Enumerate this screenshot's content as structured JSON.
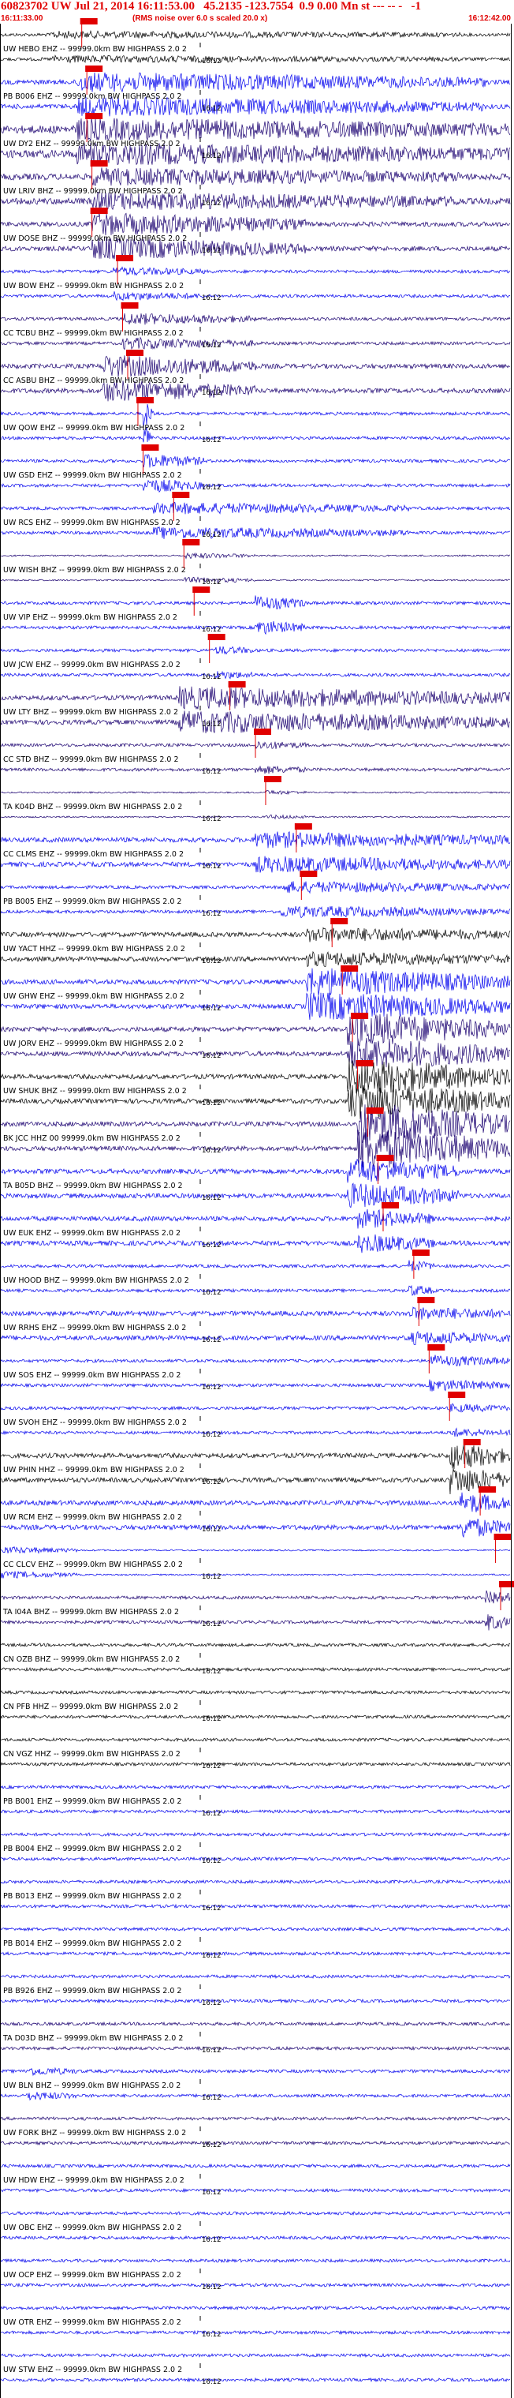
{
  "header": {
    "title": "60823702 UW Jul 21, 2014 16:11:53.00   45.2135 -123.7554  0.9 0.00 Mn st --- -- -   -1",
    "start_time": "16:11:33.00",
    "note": "(RMS noise over 6.0 s scaled 20.0 x)",
    "end_time": "16:12:42.00"
  },
  "tick_label": "16:12",
  "colors": {
    "blue": "#0000ee",
    "black": "#000000",
    "navy": "#1a0070",
    "pick": "#e00000"
  },
  "traces": [
    {
      "label": "UW HEBO EHZ -- 99999.0km BW  HIGHPASS  2.0  2",
      "color": "black",
      "pick": 0.16,
      "amp": 2,
      "burst": [
        0.1,
        0.9,
        3
      ]
    },
    {
      "label": "PB B006 EHZ -- 99999.0km BW  HIGHPASS  2.0  2",
      "color": "blue",
      "pick": 0.17,
      "amp": 3,
      "burst": [
        0.15,
        0.95,
        10
      ]
    },
    {
      "label": "UW DY2 EHZ -- 99999.0km BW  HIGHPASS  2.0  2",
      "color": "navy",
      "pick": 0.17,
      "amp": 5,
      "burst": [
        0.15,
        1.0,
        10
      ]
    },
    {
      "label": "UW LRIV BHZ -- 99999.0km BW  HIGHPASS  2.0  2",
      "color": "navy",
      "pick": 0.18,
      "amp": 4,
      "burst": [
        0.18,
        0.9,
        8
      ]
    },
    {
      "label": "UW DOSE BHZ -- 99999.0km BW  HIGHPASS  2.0  2",
      "color": "navy",
      "pick": 0.18,
      "amp": 3,
      "burst": [
        0.18,
        0.6,
        12
      ]
    },
    {
      "label": "UW BOW EHZ -- 99999.0km BW  HIGHPASS  2.0  2",
      "color": "blue",
      "pick": 0.23,
      "amp": 2,
      "burst": [
        0.22,
        0.4,
        4
      ]
    },
    {
      "label": "CC TCBU BHZ -- 99999.0km BW  HIGHPASS  2.0  2",
      "color": "navy",
      "pick": 0.24,
      "amp": 2,
      "burst": [
        0.24,
        0.5,
        6
      ]
    },
    {
      "label": "CC ASBU BHZ -- 99999.0km BW  HIGHPASS  2.0  2",
      "color": "navy",
      "pick": 0.25,
      "amp": 3,
      "burst": [
        0.2,
        0.5,
        12
      ]
    },
    {
      "label": "UW QOW EHZ -- 99999.0km BW  HIGHPASS  2.0  2",
      "color": "blue",
      "pick": 0.27,
      "amp": 2,
      "burst": [
        0.28,
        0.3,
        18
      ]
    },
    {
      "label": "UW GSD EHZ -- 99999.0km BW  HIGHPASS  2.0  2",
      "color": "blue",
      "pick": 0.28,
      "amp": 2,
      "burst": [
        0.28,
        0.4,
        8
      ]
    },
    {
      "label": "UW RCS EHZ -- 99999.0km BW  HIGHPASS  2.0  2",
      "color": "blue",
      "pick": 0.34,
      "amp": 2,
      "burst": [
        0.3,
        0.8,
        6
      ]
    },
    {
      "label": "UW WISH BHZ -- 99999.0km BW  HIGHPASS  2.0  2",
      "color": "navy",
      "pick": 0.36,
      "amp": 1,
      "burst": [
        0.36,
        0.5,
        3
      ]
    },
    {
      "label": "UW VIP EHZ -- 99999.0km BW  HIGHPASS  2.0  2",
      "color": "blue",
      "pick": 0.38,
      "amp": 2,
      "burst": [
        0.5,
        0.6,
        8
      ]
    },
    {
      "label": "UW JCW EHZ -- 99999.0km BW  HIGHPASS  2.0  2",
      "color": "blue",
      "pick": 0.41,
      "amp": 2,
      "burst": [
        0.42,
        0.5,
        4
      ]
    },
    {
      "label": "UW LTY BHZ -- 99999.0km BW  HIGHPASS  2.0  2",
      "color": "navy",
      "pick": 0.45,
      "amp": 3,
      "burst": [
        0.35,
        1.0,
        12
      ]
    },
    {
      "label": "CC STD BHZ -- 99999.0km BW  HIGHPASS  2.0  2",
      "color": "navy",
      "pick": 0.5,
      "amp": 2,
      "burst": [
        0.5,
        0.6,
        4
      ]
    },
    {
      "label": "TA K04D BHZ -- 99999.0km BW  HIGHPASS  2.0  2",
      "color": "navy",
      "pick": 0.52,
      "amp": 1,
      "burst": [
        0.52,
        0.6,
        2
      ]
    },
    {
      "label": "CC CLMS EHZ -- 99999.0km BW  HIGHPASS  2.0  2",
      "color": "blue",
      "pick": 0.58,
      "amp": 3,
      "burst": [
        0.5,
        1.0,
        8
      ]
    },
    {
      "label": "PB B005 EHZ -- 99999.0km BW  HIGHPASS  2.0  2",
      "color": "blue",
      "pick": 0.59,
      "amp": 2,
      "burst": [
        0.55,
        1.0,
        6
      ]
    },
    {
      "label": "UW YACT HHZ -- 99999.0km BW  HIGHPASS  2.0  2",
      "color": "black",
      "pick": 0.65,
      "amp": 3,
      "burst": [
        0.6,
        1.0,
        7
      ]
    },
    {
      "label": "UW GHW EHZ -- 99999.0km BW  HIGHPASS  2.0  2",
      "color": "blue",
      "pick": 0.67,
      "amp": 3,
      "burst": [
        0.6,
        1.0,
        16
      ]
    },
    {
      "label": "UW JORV EHZ -- 99999.0km BW  HIGHPASS  2.0  2",
      "color": "navy",
      "pick": 0.69,
      "amp": 3,
      "burst": [
        0.68,
        1.0,
        20
      ]
    },
    {
      "label": "UW SHUK BHZ -- 99999.0km BW  HIGHPASS  2.0  2",
      "color": "black",
      "pick": 0.7,
      "amp": 3,
      "burst": [
        0.68,
        1.0,
        22
      ]
    },
    {
      "label": "BK JCC HHZ 00 99999.0km BW  HIGHPASS  2.0  2",
      "color": "navy",
      "pick": 0.72,
      "amp": 3,
      "burst": [
        0.7,
        1.0,
        26
      ]
    },
    {
      "label": "TA B05D BHZ -- 99999.0km BW  HIGHPASS  2.0  2",
      "color": "blue",
      "pick": 0.74,
      "amp": 3,
      "burst": [
        0.68,
        0.9,
        14
      ]
    },
    {
      "label": "UW EUK EHZ -- 99999.0km BW  HIGHPASS  2.0  2",
      "color": "blue",
      "pick": 0.75,
      "amp": 3,
      "burst": [
        0.7,
        0.85,
        10
      ]
    },
    {
      "label": "UW HOOD BHZ -- 99999.0km BW  HIGHPASS  2.0  2",
      "color": "blue",
      "pick": 0.81,
      "amp": 2,
      "burst": [
        0.8,
        0.85,
        6
      ]
    },
    {
      "label": "UW RRHS EHZ -- 99999.0km BW  HIGHPASS  2.0  2",
      "color": "blue",
      "pick": 0.82,
      "amp": 3,
      "burst": [
        0.8,
        1.0,
        6
      ]
    },
    {
      "label": "UW SOS EHZ -- 99999.0km BW  HIGHPASS  2.0  2",
      "color": "blue",
      "pick": 0.84,
      "amp": 2,
      "burst": [
        0.84,
        1.0,
        6
      ]
    },
    {
      "label": "UW SVOH EHZ -- 99999.0km BW  HIGHPASS  2.0  2",
      "color": "blue",
      "pick": 0.88,
      "amp": 2,
      "burst": [
        0.88,
        1.0,
        4
      ]
    },
    {
      "label": "UW PHIN HHZ -- 99999.0km BW  HIGHPASS  2.0  2",
      "color": "black",
      "pick": 0.91,
      "amp": 3,
      "burst": [
        0.88,
        1.0,
        16
      ]
    },
    {
      "label": "UW RCM EHZ -- 99999.0km BW  HIGHPASS  2.0  2",
      "color": "blue",
      "pick": 0.94,
      "amp": 3,
      "burst": [
        0.9,
        1.0,
        12
      ]
    },
    {
      "label": "CC CLCV EHZ -- 99999.0km BW  HIGHPASS  2.0  2",
      "color": "blue",
      "pick": 0.97,
      "amp": 1,
      "burst": [
        0.0,
        0.15,
        4
      ]
    },
    {
      "label": "TA I04A BHZ -- 99999.0km BW  HIGHPASS  2.0  2",
      "color": "navy",
      "pick": 0.98,
      "amp": 2,
      "burst": [
        0.95,
        1.0,
        10
      ]
    },
    {
      "label": "CN OZB BHZ -- 99999.0km BW  HIGHPASS  2.0  2",
      "color": "black",
      "pick": null,
      "amp": 2,
      "burst": null
    },
    {
      "label": "CN PFB HHZ -- 99999.0km BW  HIGHPASS  2.0  2",
      "color": "black",
      "pick": null,
      "amp": 2,
      "burst": null
    },
    {
      "label": "CN VGZ HHZ -- 99999.0km BW  HIGHPASS  2.0  2",
      "color": "black",
      "pick": null,
      "amp": 2,
      "burst": null
    },
    {
      "label": "PB B001 EHZ -- 99999.0km BW  HIGHPASS  2.0  2",
      "color": "blue",
      "pick": null,
      "amp": 2,
      "burst": null
    },
    {
      "label": "PB B004 EHZ -- 99999.0km BW  HIGHPASS  2.0  2",
      "color": "blue",
      "pick": null,
      "amp": 2,
      "burst": null
    },
    {
      "label": "PB B013 EHZ -- 99999.0km BW  HIGHPASS  2.0  2",
      "color": "blue",
      "pick": null,
      "amp": 2,
      "burst": null
    },
    {
      "label": "PB B014 EHZ -- 99999.0km BW  HIGHPASS  2.0  2",
      "color": "blue",
      "pick": null,
      "amp": 2,
      "burst": null
    },
    {
      "label": "PB B926 EHZ -- 99999.0km BW  HIGHPASS  2.0  2",
      "color": "blue",
      "pick": null,
      "amp": 2,
      "burst": null
    },
    {
      "label": "TA D03D BHZ -- 99999.0km BW  HIGHPASS  2.0  2",
      "color": "navy",
      "pick": null,
      "amp": 2,
      "burst": null
    },
    {
      "label": "UW BLN BHZ -- 99999.0km BW  HIGHPASS  2.0  2",
      "color": "blue",
      "pick": null,
      "amp": 2,
      "burst": [
        0.05,
        0.15,
        4
      ]
    },
    {
      "label": "UW FORK BHZ -- 99999.0km BW  HIGHPASS  2.0  2",
      "color": "navy",
      "pick": null,
      "amp": 2,
      "burst": null
    },
    {
      "label": "UW HDW EHZ -- 99999.0km BW  HIGHPASS  2.0  2",
      "color": "blue",
      "pick": null,
      "amp": 2,
      "burst": null
    },
    {
      "label": "UW OBC EHZ -- 99999.0km BW  HIGHPASS  2.0  2",
      "color": "blue",
      "pick": null,
      "amp": 2,
      "burst": null
    },
    {
      "label": "UW OCP EHZ -- 99999.0km BW  HIGHPASS  2.0  2",
      "color": "blue",
      "pick": null,
      "amp": 2,
      "burst": null
    },
    {
      "label": "UW OTR EHZ -- 99999.0km BW  HIGHPASS  2.0  2",
      "color": "blue",
      "pick": null,
      "amp": 2,
      "burst": null
    },
    {
      "label": "UW STW EHZ -- 99999.0km BW  HIGHPASS  2.0  2",
      "color": "blue",
      "pick": null,
      "amp": 2,
      "burst": null
    }
  ]
}
